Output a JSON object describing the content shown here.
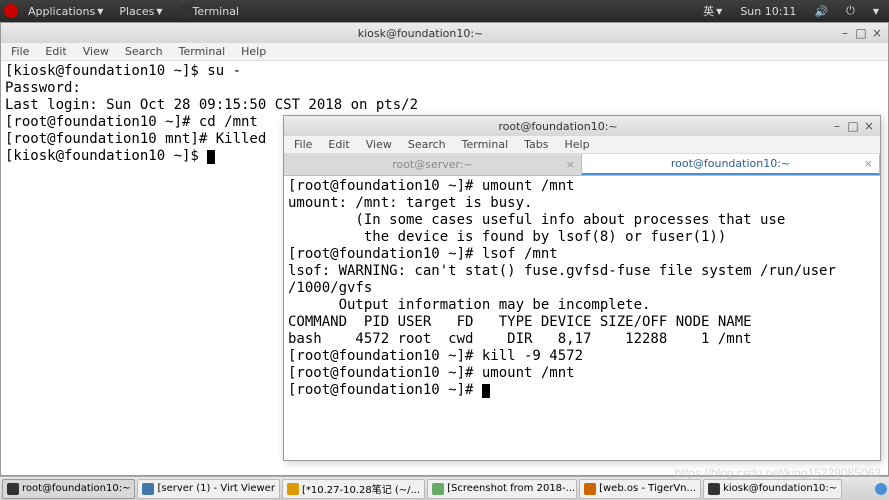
{
  "top_panel": {
    "applications": "Applications",
    "places": "Places",
    "terminal": "Terminal",
    "ime": "英",
    "time": "Sun 10:11"
  },
  "bg_window": {
    "title": "kiosk@foundation10:~",
    "menu": {
      "file": "File",
      "edit": "Edit",
      "view": "View",
      "search": "Search",
      "terminal": "Terminal",
      "help": "Help"
    },
    "lines": "[kiosk@foundation10 ~]$ su -\nPassword:\nLast login: Sun Oct 28 09:15:50 CST 2018 on pts/2\n[root@foundation10 ~]# cd /mnt\n[root@foundation10 mnt]# Killed\n[kiosk@foundation10 ~]$ "
  },
  "fg_window": {
    "title": "root@foundation10:~",
    "menu": {
      "file": "File",
      "edit": "Edit",
      "view": "View",
      "search": "Search",
      "terminal": "Terminal",
      "tabs": "Tabs",
      "help": "Help"
    },
    "tabs": [
      {
        "label": "root@server:~",
        "active": false
      },
      {
        "label": "root@foundation10:~",
        "active": true
      }
    ],
    "lines": "[root@foundation10 ~]# umount /mnt\numount: /mnt: target is busy.\n        (In some cases useful info about processes that use\n         the device is found by lsof(8) or fuser(1))\n[root@foundation10 ~]# lsof /mnt\nlsof: WARNING: can't stat() fuse.gvfsd-fuse file system /run/user\n/1000/gvfs\n      Output information may be incomplete.\nCOMMAND  PID USER   FD   TYPE DEVICE SIZE/OFF NODE NAME\nbash    4572 root  cwd    DIR   8,17    12288    1 /mnt\n[root@foundation10 ~]# kill -9 4572\n[root@foundation10 ~]# umount /mnt\n[root@foundation10 ~]# "
  },
  "taskbar": {
    "items": [
      "root@foundation10:~",
      "[server (1) - Virt Viewer",
      "[*10.27-10.28笔记 (~/...",
      "[Screenshot from 2018-...",
      "[web.os - TigerVn...",
      "kiosk@foundation10:~"
    ]
  },
  "watermark": "https://blog.csdn.net/king15229085063"
}
